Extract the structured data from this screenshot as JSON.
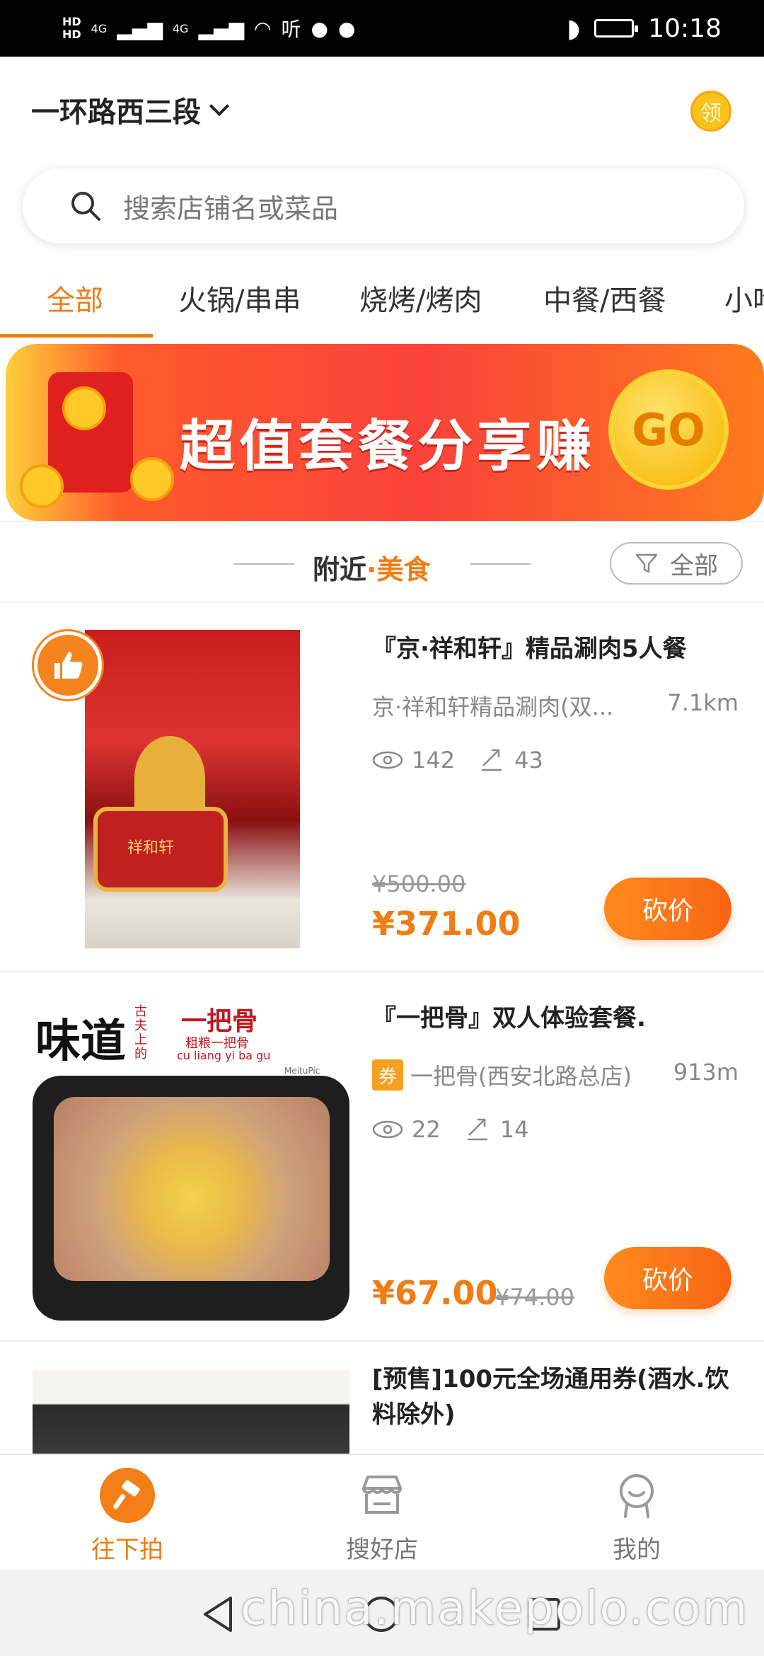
{
  "status_bar": {
    "net1": "HD",
    "net2": "HD",
    "sig1": "4G",
    "sig2": "4G",
    "app_label": "听",
    "time": "10:18"
  },
  "header": {
    "location": "一环路西三段",
    "coupon_label": "领"
  },
  "search": {
    "placeholder": "搜索店铺名或菜品"
  },
  "tabs": [
    {
      "label": "全部"
    },
    {
      "label": "火锅/串串"
    },
    {
      "label": "烧烤/烤肉"
    },
    {
      "label": "中餐/西餐"
    },
    {
      "label": "小吃"
    }
  ],
  "banner": {
    "text": "超值套餐分享赚",
    "go_label": "GO"
  },
  "section": {
    "title_prefix": "附近",
    "dot": "·",
    "title_accent": "美食",
    "filter_label": "全部"
  },
  "items": [
    {
      "title": "『京·祥和轩』精品涮肉5人餐",
      "shop": "京·祥和轩精品涮肉(双...",
      "distance": "7.1km",
      "views": "142",
      "shares": "43",
      "original_price": "¥500.00",
      "price": "¥371.00",
      "button": "砍价",
      "image_caption": "祥和轩"
    },
    {
      "title": "『一把骨』双人体验套餐.",
      "coupon_tag": "券",
      "shop": "一把骨(西安北路总店)",
      "distance": "913m",
      "views": "22",
      "shares": "14",
      "price": "¥67.00",
      "original_price": "¥74.00",
      "button": "砍价",
      "image_text_big": "味道",
      "image_text_brand": "一把骨",
      "image_text_sub": "粗粮一把骨",
      "image_text_pinyin": "cu liang yi ba gu",
      "image_text_side": "古夫上的",
      "image_text_watermark": "MeituPic"
    },
    {
      "title": "[预售]100元全场通用券(酒水.饮料除外)"
    }
  ],
  "bottom_nav": [
    {
      "label": "往下拍",
      "active": true
    },
    {
      "label": "搜好店",
      "active": false
    },
    {
      "label": "我的",
      "active": false
    }
  ],
  "watermark": "china.makepolo.com",
  "colors": {
    "accent": "#f07c14",
    "button_gradient_start": "#ff8a1c",
    "button_gradient_end": "#f96515"
  }
}
